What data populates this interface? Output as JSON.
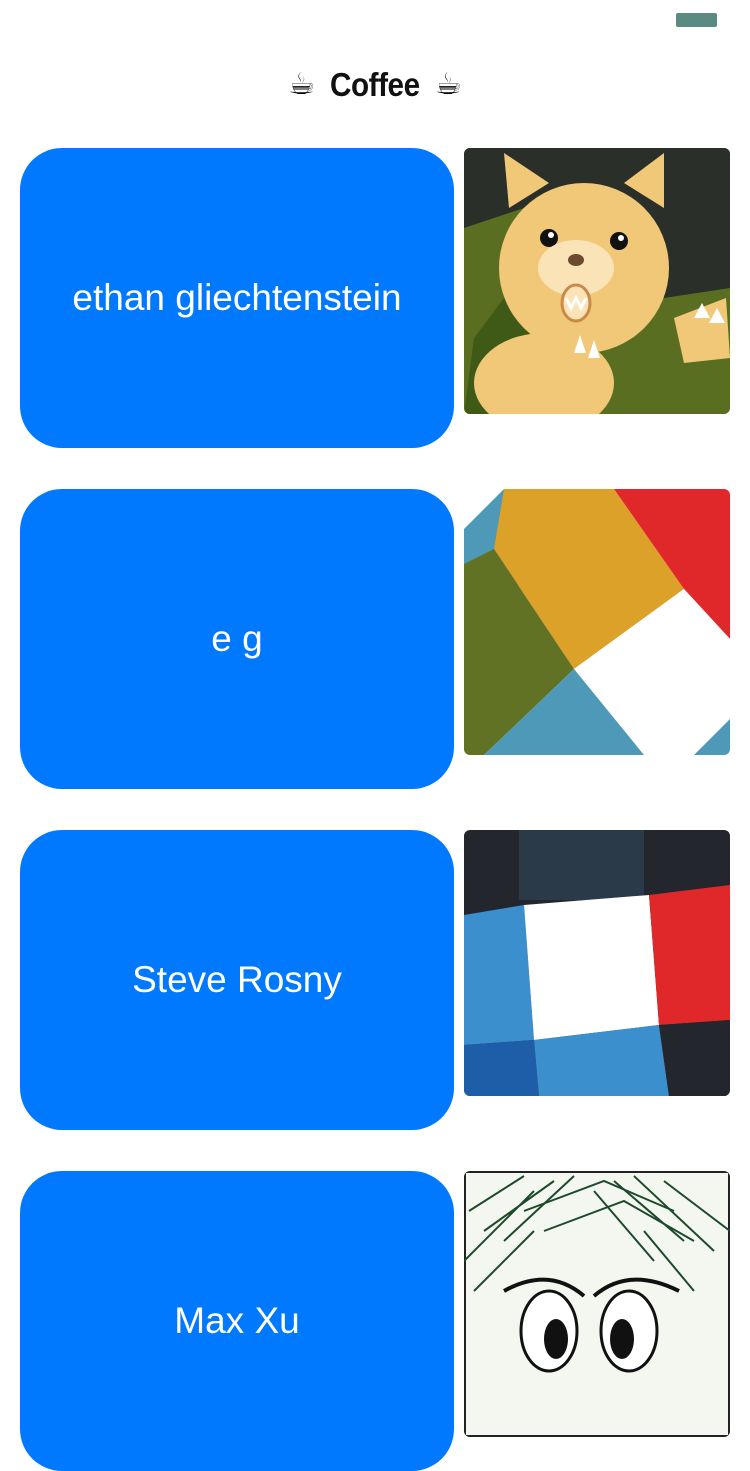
{
  "header": {
    "title": "Coffee",
    "left_icon": "coffee-cup-icon",
    "right_icon": "coffee-cup-icon",
    "cup_glyph": "☕"
  },
  "colors": {
    "card_blue": "#0079ff",
    "status_indicator": "#5a8a82"
  },
  "people": [
    {
      "name": "ethan gliechtenstein",
      "avatar": "cartoon-bear-avatar"
    },
    {
      "name": "e g",
      "avatar": "geometric-stripes-avatar"
    },
    {
      "name": "Steve Rosny",
      "avatar": "plaid-squares-avatar"
    },
    {
      "name": "Max Xu",
      "avatar": "sketch-face-avatar"
    }
  ]
}
